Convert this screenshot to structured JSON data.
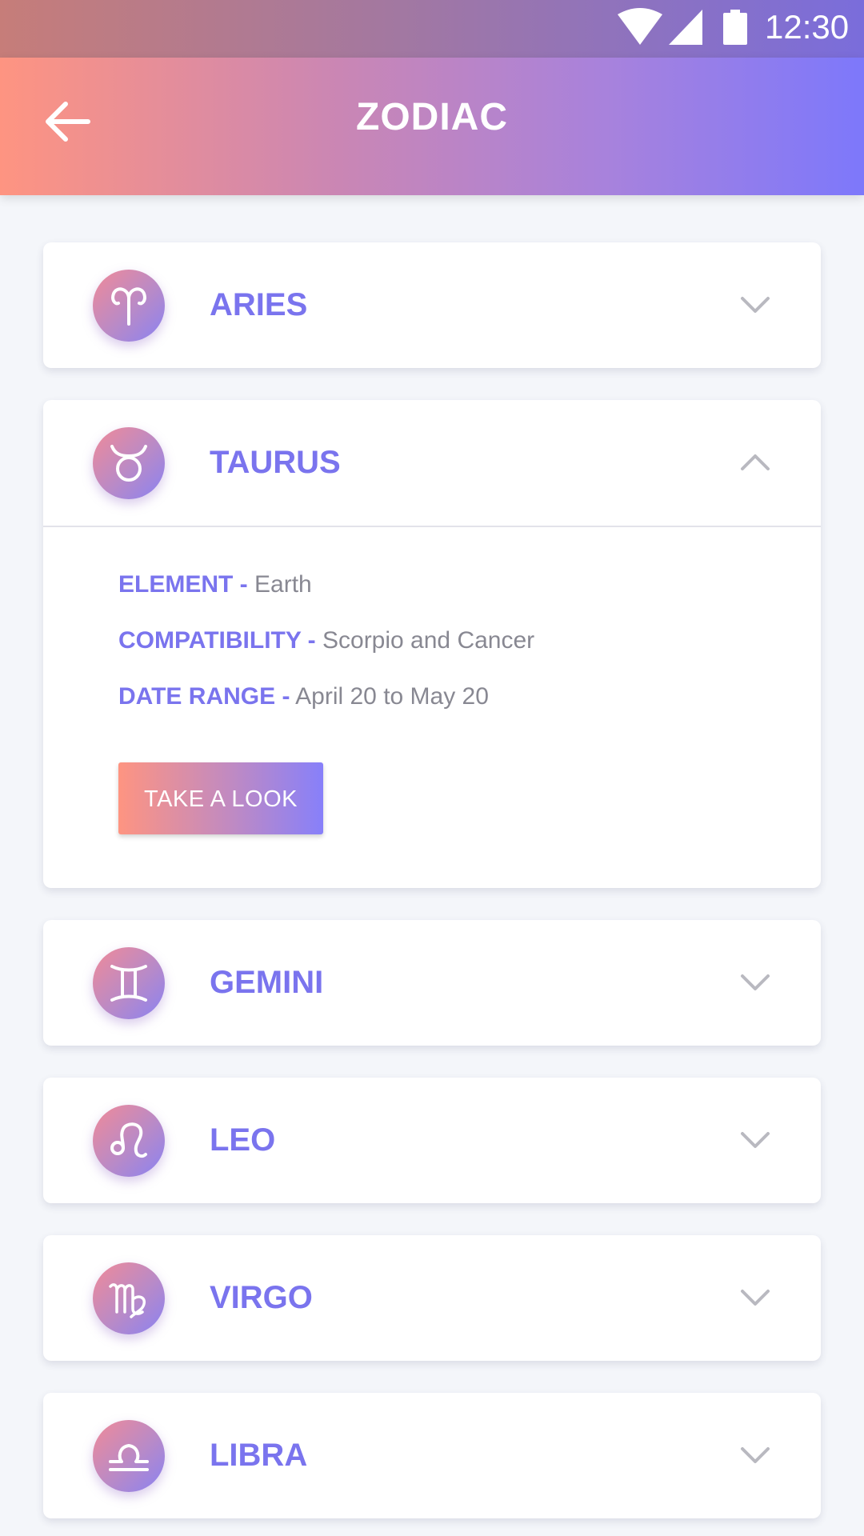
{
  "status_bar": {
    "time": "12:30",
    "icons": [
      "wifi-icon",
      "signal-icon",
      "battery-icon"
    ]
  },
  "app_bar": {
    "title": "ZODIAC",
    "back_icon": "arrow-left-icon"
  },
  "colors": {
    "accent": "#7a74ee",
    "gradient_start": "#fe9481",
    "gradient_end": "#7d78fb",
    "muted_text": "#888892",
    "background": "#f4f6fa"
  },
  "signs": [
    {
      "name": "ARIES",
      "icon": "aries-icon",
      "expanded": false,
      "chevron": "chevron-down-icon"
    },
    {
      "name": "TAURUS",
      "icon": "taurus-icon",
      "expanded": true,
      "chevron": "chevron-up-icon",
      "details": {
        "element_label": "ELEMENT -",
        "element_value": "Earth",
        "compatibility_label": "COMPATIBILITY -",
        "compatibility_value": "Scorpio and Cancer",
        "date_range_label": "DATE RANGE -",
        "date_range_value": "April 20 to May 20",
        "button_label": "TAKE A LOOK"
      }
    },
    {
      "name": "GEMINI",
      "icon": "gemini-icon",
      "expanded": false,
      "chevron": "chevron-down-icon"
    },
    {
      "name": "LEO",
      "icon": "leo-icon",
      "expanded": false,
      "chevron": "chevron-down-icon"
    },
    {
      "name": "VIRGO",
      "icon": "virgo-icon",
      "expanded": false,
      "chevron": "chevron-down-icon"
    },
    {
      "name": "LIBRA",
      "icon": "libra-icon",
      "expanded": false,
      "chevron": "chevron-down-icon"
    }
  ]
}
